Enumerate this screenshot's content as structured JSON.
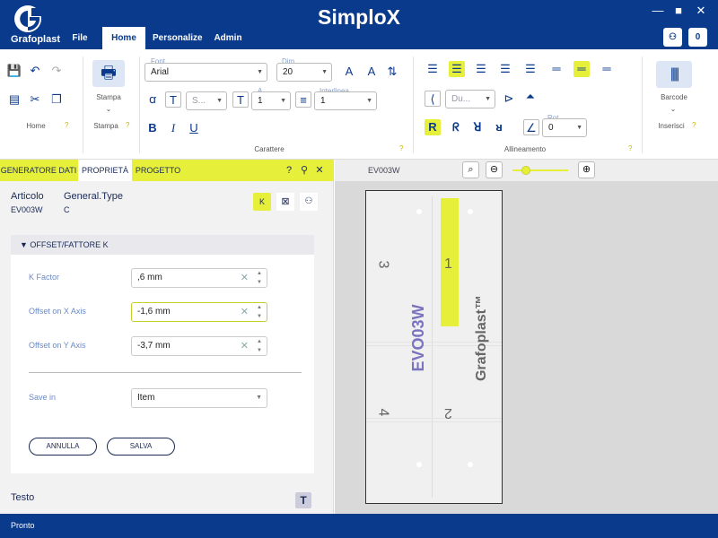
{
  "app": {
    "title": "SimploX",
    "logo_text": "Grafoplast",
    "user_initial": "0"
  },
  "menu": {
    "items": [
      "File",
      "Home",
      "Personalize",
      "Admin"
    ],
    "active": "Home"
  },
  "ribbon": {
    "home_label": "Home",
    "stampa_label": "Stampa",
    "stampa_group": "Stampa",
    "font_label": "Font",
    "font_value": "Arial",
    "dim_label": "Dim",
    "dim_value": "20",
    "s_value": "S...",
    "a_label": "A",
    "a_value": "1",
    "interlinea_label": "Interlinea",
    "interlinea_value": "1",
    "carattere_group": "Carattere",
    "du_value": "Du...",
    "rot_label": "Rot.",
    "rot_value": "0",
    "allineamento_group": "Allineamento",
    "barcode_label": "Barcode",
    "inserisci_group": "Inserisci",
    "qmark": "?"
  },
  "panel": {
    "tabs": [
      "GENERATORE DATI",
      "PROPRIETÀ",
      "PROGETTO"
    ],
    "active_tab": "PROPRIETÀ",
    "articolo_label": "Articolo",
    "articolo_value": "EV003W",
    "type_label": "General.Type",
    "type_value": "C",
    "k_button": "K",
    "group_title": "OFFSET/FATTORE K",
    "kfactor_label": "K Factor",
    "kfactor_value": ",6 mm",
    "offx_label": "Offset on X Axis",
    "offx_value": "-1,6 mm",
    "offy_label": "Offset on Y Axis",
    "offy_value": "-3,7 mm",
    "savein_label": "Save in",
    "savein_value": "Item",
    "annulla": "ANNULLA",
    "salva": "SALVA",
    "testo_label": "Testo"
  },
  "canvas": {
    "doc_tab": "EV003W",
    "label_numbers": [
      "3",
      "1",
      "4",
      "2"
    ],
    "label_code": "EVO03W",
    "label_brand": "Grafoplast™",
    "highlight_color": "#e6f03a"
  },
  "status": {
    "text": "Pronto"
  }
}
